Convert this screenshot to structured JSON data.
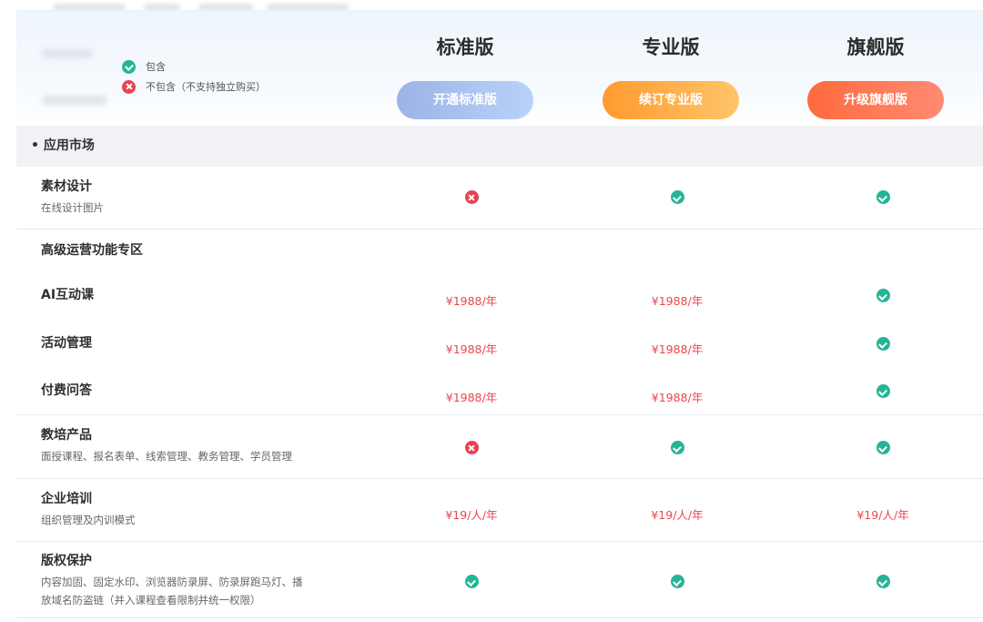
{
  "legend": {
    "included": "包含",
    "excluded": "不包含（不支持独立购买）"
  },
  "plans": [
    {
      "name": "标准版",
      "button": "开通标准版"
    },
    {
      "name": "专业版",
      "button": "续订专业版"
    },
    {
      "name": "旗舰版",
      "button": "升级旗舰版"
    }
  ],
  "section": {
    "title": "• 应用市场"
  },
  "rows": {
    "material": {
      "title": "素材设计",
      "desc": "在线设计图片",
      "values": [
        "no",
        "yes",
        "yes"
      ]
    },
    "advanced": {
      "title": "高级运营功能专区"
    },
    "ai": {
      "title": "AI互动课",
      "values": [
        "¥1988/年",
        "¥1988/年",
        "yes"
      ]
    },
    "activity": {
      "title": "活动管理",
      "values": [
        "¥1988/年",
        "¥1988/年",
        "yes"
      ]
    },
    "qa": {
      "title": "付费问答",
      "values": [
        "¥1988/年",
        "¥1988/年",
        "yes"
      ]
    },
    "edu": {
      "title": "教培产品",
      "desc": "面授课程、报名表单、线索管理、教务管理、学员管理",
      "values": [
        "no",
        "yes",
        "yes"
      ]
    },
    "training": {
      "title": "企业培训",
      "desc": "组织管理及内训模式",
      "values": [
        "¥19/人/年",
        "¥19/人/年",
        "¥19/人/年"
      ]
    },
    "copyright": {
      "title": "版权保护",
      "desc_line1": "内容加固、固定水印、浏览器防录屏、防录屏跑马灯、播",
      "desc_line2": "放域名防盗链（并入课程查看限制并统一权限）",
      "values": [
        "yes",
        "yes",
        "yes"
      ]
    }
  },
  "icons": {
    "included": "check-circle-icon",
    "excluded": "cross-circle-icon"
  },
  "colors": {
    "included": "#23b596",
    "excluded": "#e64354",
    "price": "#e8484f",
    "standard_button": "#9cb3e6",
    "pro_button": "#ff9a2e",
    "flagship_button": "#ff6a3d"
  }
}
